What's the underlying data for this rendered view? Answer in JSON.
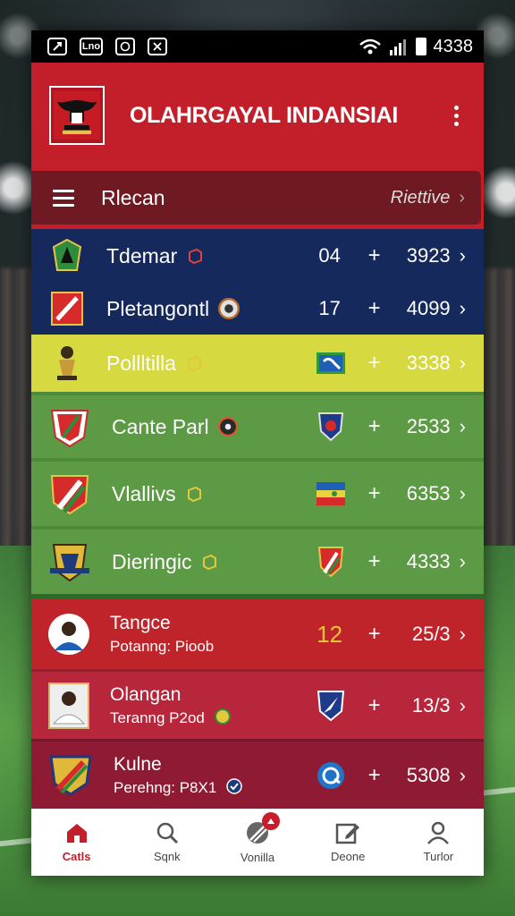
{
  "status_bar": {
    "time": "4338",
    "left_icons": [
      "image-icon",
      "link-box-icon",
      "whatsapp-icon",
      "tools-icon"
    ],
    "left_icon_text": [
      "",
      "Lno",
      "",
      ""
    ]
  },
  "app": {
    "title": "OLAHRGAYAL INDANSIAI",
    "brand_color": "#c31f2b"
  },
  "filter": {
    "title": "Rlecan",
    "right_label": "Riettive",
    "chevron": "›"
  },
  "rows": [
    {
      "name": "Tdemar",
      "mid": "04",
      "plus": "+",
      "score": "3923",
      "chev": "›",
      "bg": "#15295c"
    },
    {
      "name": "Pletangontl",
      "mid": "17",
      "plus": "+",
      "score": "4099",
      "chev": "›",
      "bg": "#15295c"
    },
    {
      "name": "Pollltilla",
      "plus": "+",
      "score": "3338",
      "chev": "›",
      "bg": "#d6d940"
    },
    {
      "name": "Cante Parl",
      "plus": "+",
      "score": "2533",
      "chev": "›",
      "bg": "#5d9a45"
    },
    {
      "name": "Vlallivs",
      "plus": "+",
      "score": "6353",
      "chev": "›",
      "bg": "#5d9a45"
    },
    {
      "name": "Dieringic",
      "plus": "+",
      "score": "4333",
      "chev": "›",
      "bg": "#5d9a45"
    },
    {
      "name": "Tangce",
      "sub": "Potanng: Pioob",
      "mid": "12",
      "plus": "+",
      "score": "25/3",
      "chev": "›",
      "bg": "#c0242b"
    },
    {
      "name": "Olangan",
      "sub": "Teranng P2od",
      "plus": "+",
      "score": "13/3",
      "chev": "›",
      "bg": "#b7263a"
    },
    {
      "name": "Kulne",
      "sub": "Perehng: P8X1",
      "plus": "+",
      "score": "5308",
      "chev": "›",
      "bg": "#8e1b33"
    }
  ],
  "nav": [
    {
      "label": "Catls",
      "icon": "home-icon",
      "active": true
    },
    {
      "label": "Sqnk",
      "icon": "search-icon",
      "active": false
    },
    {
      "label": "Vonilla",
      "icon": "ball-icon",
      "active": false,
      "badge": true
    },
    {
      "label": "Deone",
      "icon": "edit-icon",
      "active": false
    },
    {
      "label": "Turlor",
      "icon": "profile-icon",
      "active": false
    }
  ]
}
